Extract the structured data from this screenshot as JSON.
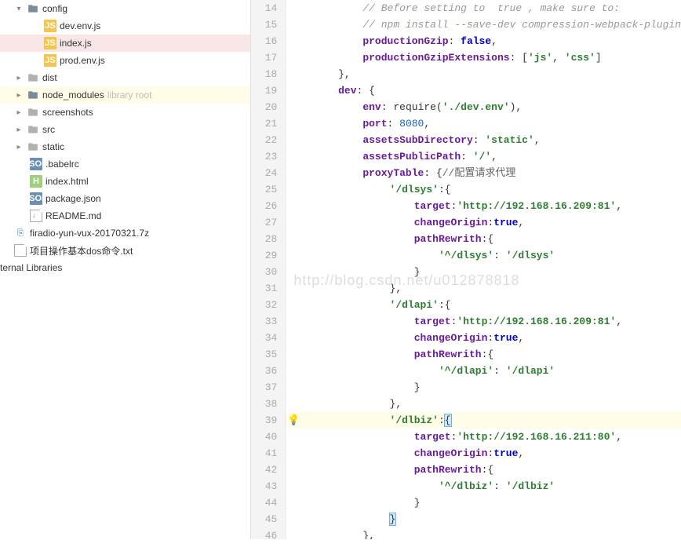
{
  "tree": {
    "config": "config",
    "dev_env": "dev.env.js",
    "index": "index.js",
    "prod_env": "prod.env.js",
    "dist": "dist",
    "node_modules": "node_modules",
    "lib_root": "library root",
    "screenshots": "screenshots",
    "src": "src",
    "static": "static",
    "babelrc": ".babelrc",
    "index_html": "index.html",
    "package_json": "package.json",
    "readme": "README.md",
    "firadio": "firadio-yun-vux-20170321.7z",
    "dos_txt": "项目操作基本dos命令.txt",
    "ext_lib": "ternal Libraries"
  },
  "watermark": "http://blog.csdn.net/u012878818",
  "gutter": {
    "start": 14,
    "end": 46
  },
  "code": {
    "l14": "// Before setting to  true , make sure to:",
    "l15": "// npm install --save-dev compression-webpack-plugin",
    "l16_p": "productionGzip",
    "l16_v": "false",
    "l17_p": "productionGzipExtensions",
    "l17_a": "'js'",
    "l17_b": "'css'",
    "l19_p": "dev",
    "l20_p": "env",
    "l20_f": "require",
    "l20_s": "'./dev.env'",
    "l21_p": "port",
    "l21_v": "8080",
    "l22_p": "assetsSubDirectory",
    "l22_s": "'static'",
    "l23_p": "assetsPublicPath",
    "l23_s": "'/'",
    "l24_p": "proxyTable",
    "l24_c": "//配置请求代理",
    "l25_s": "'/dlsys'",
    "l26_p": "target",
    "l26_s": "'http://192.168.16.209:81'",
    "l27_p": "changeOrigin",
    "l27_v": "true",
    "l28_p": "pathRewrith",
    "l29_a": "'^/dlsys'",
    "l29_b": "'/dlsys'",
    "l32_s": "'/dlapi'",
    "l33_p": "target",
    "l33_s": "'http://192.168.16.209:81'",
    "l34_p": "changeOrigin",
    "l34_v": "true",
    "l35_p": "pathRewrith",
    "l36_a": "'^/dlapi'",
    "l36_b": "'/dlapi'",
    "l39_s": "'/dlbiz'",
    "l40_p": "target",
    "l40_s": "'http://192.168.16.211:80'",
    "l41_p": "changeOrigin",
    "l41_v": "true",
    "l42_p": "pathRewrith",
    "l43_a": "'^/dlbiz'",
    "l43_b": "'/dlbiz'"
  }
}
